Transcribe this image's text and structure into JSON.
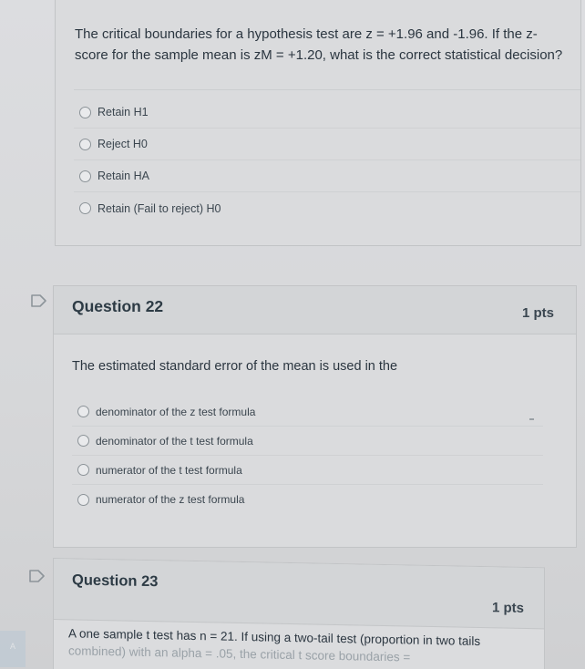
{
  "q21": {
    "text_line1": "The critical boundaries for a hypothesis test are z = +1.96 and -1.96. If the z-",
    "text_line2": "score for the sample mean is zM = +1.20, what is the correct statistical decision?",
    "answers": [
      {
        "label": "Retain H1"
      },
      {
        "label": "Reject H0"
      },
      {
        "label": "Retain HA"
      },
      {
        "label": "Retain (Fail to reject) H0"
      }
    ]
  },
  "q22": {
    "title": "Question 22",
    "points": "1 pts",
    "text": "The estimated standard error of the mean is used in the",
    "answers": [
      {
        "label": "denominator of the z test formula"
      },
      {
        "label": "denominator of the t test formula"
      },
      {
        "label": "numerator of the t test formula"
      },
      {
        "label": "numerator of the z test formula"
      }
    ]
  },
  "q23": {
    "title": "Question 23",
    "points": "1 pts",
    "text_line1": "A one sample t test has n = 21. If using a two-tail test (proportion in two tails",
    "text_line2": "combined) with an alpha = .05, the critical t score boundaries ="
  },
  "side_badge": "A",
  "colors": {
    "flag": "#8d949a",
    "radio_border": "#8c9398",
    "text": "#2d3b45"
  }
}
